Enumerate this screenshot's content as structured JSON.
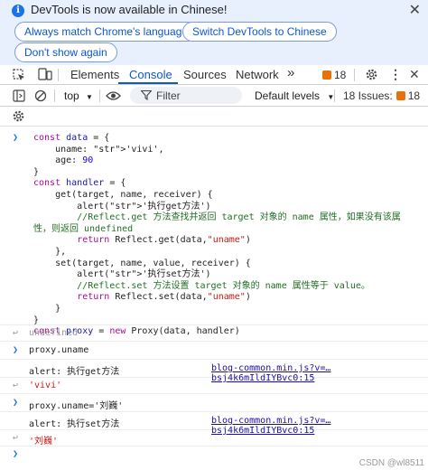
{
  "notice": {
    "message": "DevTools is now available in Chinese!",
    "btn_match": "Always match Chrome's language",
    "btn_switch": "Switch DevTools to Chinese",
    "btn_dont_show": "Don't show again"
  },
  "tabs": {
    "elements": "Elements",
    "console": "Console",
    "sources": "Sources",
    "network": "Network",
    "more": "»",
    "issues_count": "18"
  },
  "toolbar": {
    "context": "top",
    "filter_placeholder": "Filter",
    "levels": "Default levels",
    "issues_label": "18 Issues:",
    "issues_count": "18"
  },
  "console": {
    "code_lines": [
      "const data = {",
      "    uname: 'vivi',",
      "    age: 90",
      "}",
      "const handler = {",
      "    get(target, name, receiver) {",
      "        alert('执行get方法')",
      "        //Reflect.get 方法查找并返回 target 对象的 name 属性，如果没有该属",
      "性，则返回 undefined",
      "        return Reflect.get(data,\"uname\")",
      "    },",
      "    set(target, name, value, receiver) {",
      "        alert('执行set方法')",
      "        //Reflect.set 方法设置 target 对象的 name 属性等于 value。",
      "        return Reflect.set(data,\"uname\")",
      "    }",
      "}",
      "const proxy = new Proxy(data, handler)"
    ],
    "result_undefined": "undefined",
    "cmd_get": "proxy.uname",
    "alert_get": "alert: 执行get方法",
    "link": "blog-common.min.js?v=…bsj4k6mIldIYBvc0:15",
    "result_get": "'vivi'",
    "cmd_set": "proxy.uname='刘巍'",
    "alert_set": "alert: 执行set方法",
    "result_set": "'刘巍'"
  },
  "watermark": "CSDN @wl8511"
}
